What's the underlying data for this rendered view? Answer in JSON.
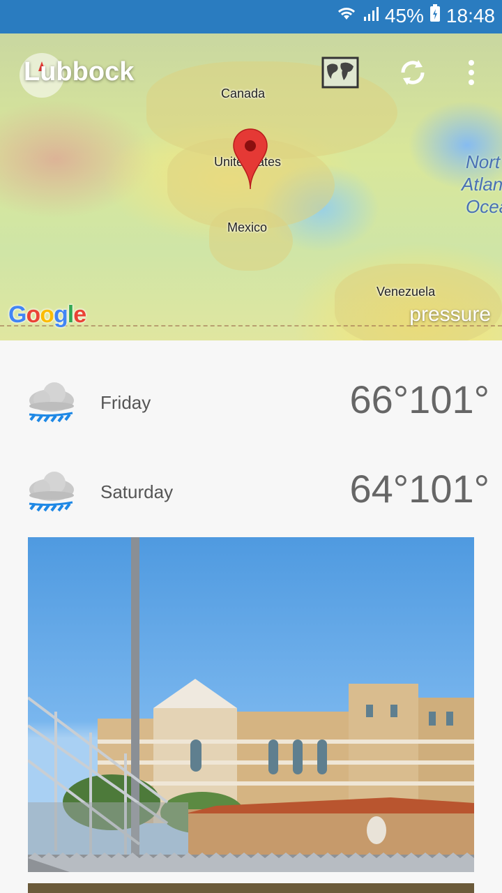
{
  "status_bar": {
    "battery": "45%",
    "time": "18:48"
  },
  "header": {
    "city": "Lubbock"
  },
  "map": {
    "labels": {
      "canada": "Canada",
      "usa": "Unite   tates",
      "mexico": "Mexico",
      "venezuela": "Venezuela"
    },
    "ocean_label": [
      "Nort",
      "Atlan",
      "Ocea"
    ],
    "layer_label": "pressure",
    "logo": "Google"
  },
  "forecast": [
    {
      "day": "Friday",
      "low": "66°",
      "high": "101°",
      "icon": "rain-cloud-icon"
    },
    {
      "day": "Saturday",
      "low": "64°",
      "high": "101°",
      "icon": "rain-cloud-icon"
    }
  ]
}
